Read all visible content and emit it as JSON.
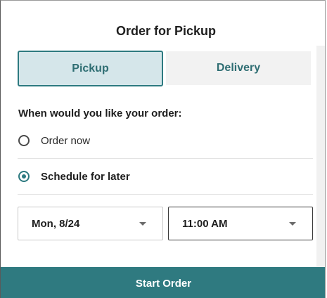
{
  "modal": {
    "title": "Order for Pickup"
  },
  "order_type": {
    "selected": "Pickup",
    "options": [
      "Pickup",
      "Delivery"
    ]
  },
  "timing": {
    "question": "When would you like your order:",
    "options": [
      {
        "label": "Order now",
        "selected": false
      },
      {
        "label": "Schedule for later",
        "selected": true
      }
    ]
  },
  "schedule": {
    "date": "Mon, 8/24",
    "time": "11:00 AM"
  },
  "cta": {
    "label": "Start Order"
  },
  "colors": {
    "accent": "#2f7a80",
    "accent_text": "#2f6e73",
    "selected_tab_bg": "#d5e6ea",
    "unselected_tab_bg": "#f2f2f2"
  }
}
